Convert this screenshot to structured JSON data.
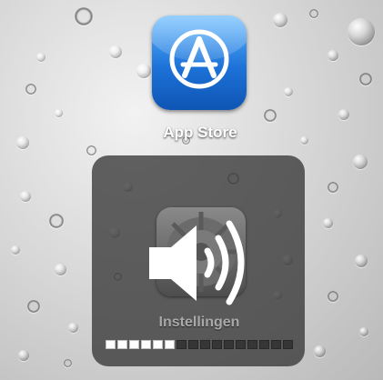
{
  "home_screen": {
    "app_store": {
      "label": "App Store",
      "icon": "app-store-icon"
    }
  },
  "volume_hud": {
    "icon": "speaker-volume-icon",
    "background_app_label": "Instellingen",
    "volume": {
      "level": 0.375,
      "filled_segments": 6,
      "total_segments": 16
    }
  },
  "colors": {
    "hud_background": "#373737",
    "segment_on": "#ffffff",
    "segment_off": "#363636",
    "app_store_blue": "#1d72d8"
  }
}
